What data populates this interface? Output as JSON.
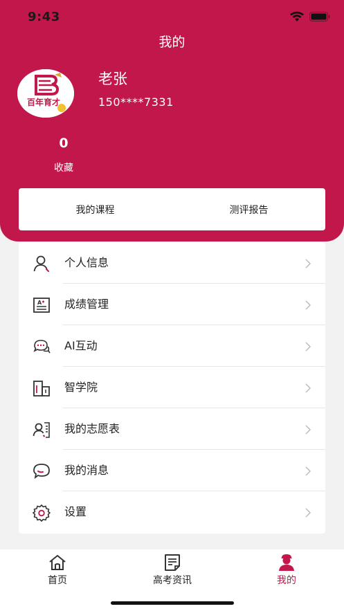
{
  "status_bar": {
    "time": "9:43"
  },
  "header": {
    "title": "我的"
  },
  "profile": {
    "name": "老张",
    "phone": "150****7331",
    "avatar_logo_text": "百年育才"
  },
  "stats": {
    "favorites_count": "0",
    "favorites_label": "收藏"
  },
  "tabs": {
    "courses": "我的课程",
    "reports": "测评报告"
  },
  "menu": [
    {
      "label": "个人信息",
      "icon": "person-icon"
    },
    {
      "label": "成绩管理",
      "icon": "grade-icon"
    },
    {
      "label": "AI互动",
      "icon": "chat-bubble-icon"
    },
    {
      "label": "智学院",
      "icon": "building-icon"
    },
    {
      "label": "我的志愿表",
      "icon": "volunteer-list-icon"
    },
    {
      "label": "我的消息",
      "icon": "message-icon"
    },
    {
      "label": "设置",
      "icon": "gear-icon"
    }
  ],
  "bottom_nav": [
    {
      "label": "首页",
      "icon": "home-icon",
      "active": false
    },
    {
      "label": "高考资讯",
      "icon": "news-icon",
      "active": false
    },
    {
      "label": "我的",
      "icon": "user-avatar-icon",
      "active": true
    }
  ],
  "colors": {
    "brand": "#c2174a",
    "background": "#f2f2f2"
  }
}
